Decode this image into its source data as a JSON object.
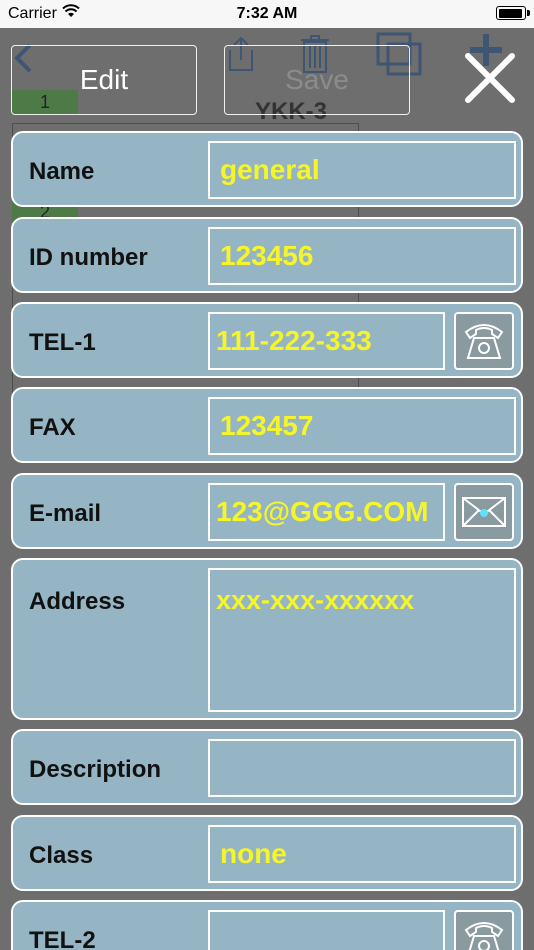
{
  "status_bar": {
    "carrier": "Carrier",
    "time": "7:32 AM"
  },
  "background": {
    "title": "YKK-3",
    "row_numbers": [
      "1",
      "2"
    ],
    "icons": [
      "back-chevron-icon",
      "share-icon",
      "trash-icon",
      "copy-icon",
      "plus-icon"
    ]
  },
  "header": {
    "edit_label": "Edit",
    "save_label": "Save",
    "close_icon": "close-icon"
  },
  "form": {
    "name": {
      "label": "Name",
      "value": "general"
    },
    "id_number": {
      "label": "ID number",
      "value": "123456"
    },
    "tel1": {
      "label": "TEL-1",
      "value": "111-222-333",
      "action_icon": "telephone-icon"
    },
    "fax": {
      "label": "FAX",
      "value": "123457"
    },
    "email": {
      "label": "E-mail",
      "value": "123@GGG.COM",
      "action_icon": "envelope-icon"
    },
    "address": {
      "label": "Address",
      "value": "xxx-xxx-xxxxxx"
    },
    "description": {
      "label": "Description",
      "value": ""
    },
    "class": {
      "label": "Class",
      "value": "none"
    },
    "tel2": {
      "label": "TEL-2",
      "value": "",
      "action_icon": "telephone-icon"
    }
  },
  "colors": {
    "row_bg": "#95b5c4",
    "value_text": "#f5f52a",
    "overlay": "#6e6e6e"
  }
}
